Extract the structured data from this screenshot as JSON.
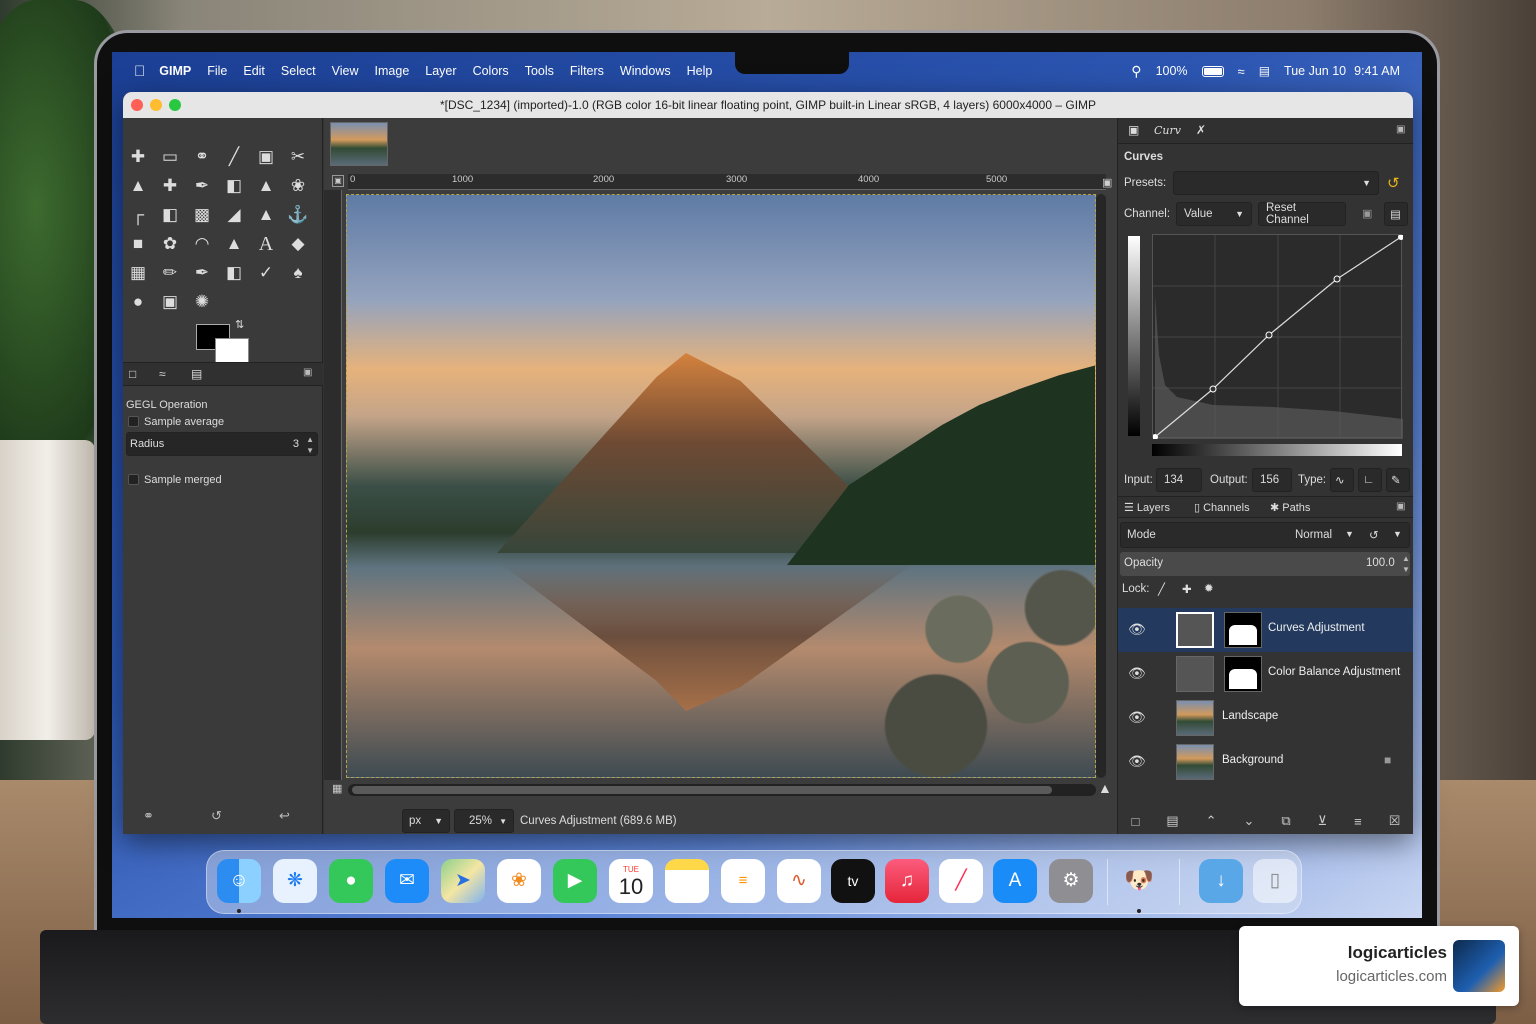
{
  "menubar": {
    "apple_icon": "apple-icon",
    "app_name": "GIMP",
    "items": [
      "File",
      "Edit",
      "Select",
      "View",
      "Image",
      "Layer",
      "Colors",
      "Tools",
      "Filters",
      "Windows",
      "Help"
    ],
    "battery": "100%",
    "date": "Tue Jun 10",
    "time": "9:41 AM"
  },
  "window": {
    "title": "*[DSC_1234] (imported)-1.0 (RGB color 16-bit linear floating point, GIMP built-in Linear sRGB, 4 layers) 6000x4000 – GIMP"
  },
  "tool_options": {
    "title": "GEGL Operation",
    "sample_average": "Sample average",
    "radius_label": "Radius",
    "radius_value": "3",
    "sample_merged": "Sample merged"
  },
  "ruler": {
    "ticks": [
      "0",
      "1000",
      "2000",
      "3000",
      "4000",
      "5000"
    ]
  },
  "statusbar": {
    "unit": "px",
    "zoom": "25%",
    "message": "Curves Adjustment (689.6 MB)"
  },
  "curves": {
    "tab_label": "Curv",
    "title": "Curves",
    "presets_label": "Presets:",
    "channel_label": "Channel:",
    "channel_value": "Value",
    "reset_button": "Reset Channel",
    "input_label": "Input:",
    "input_value": "134",
    "output_label": "Output:",
    "output_value": "156",
    "type_label": "Type:"
  },
  "layers_panel": {
    "tabs": [
      "Layers",
      "Channels",
      "Paths"
    ],
    "mode_label": "Mode",
    "mode_value": "Normal",
    "opacity_label": "Opacity",
    "opacity_value": "100.0",
    "lock_label": "Lock:",
    "layers": [
      {
        "name": "Curves Adjustment",
        "selected": true
      },
      {
        "name": "Color Balance Adjustment",
        "selected": false
      },
      {
        "name": "Landscape",
        "selected": false
      },
      {
        "name": "Background",
        "selected": false,
        "locked": true
      }
    ]
  },
  "dock": {
    "calendar_month": "TUE",
    "calendar_day": "10",
    "tv_label": "tv"
  },
  "watermark": {
    "name": "logicarticles",
    "url": "logicarticles.com"
  }
}
